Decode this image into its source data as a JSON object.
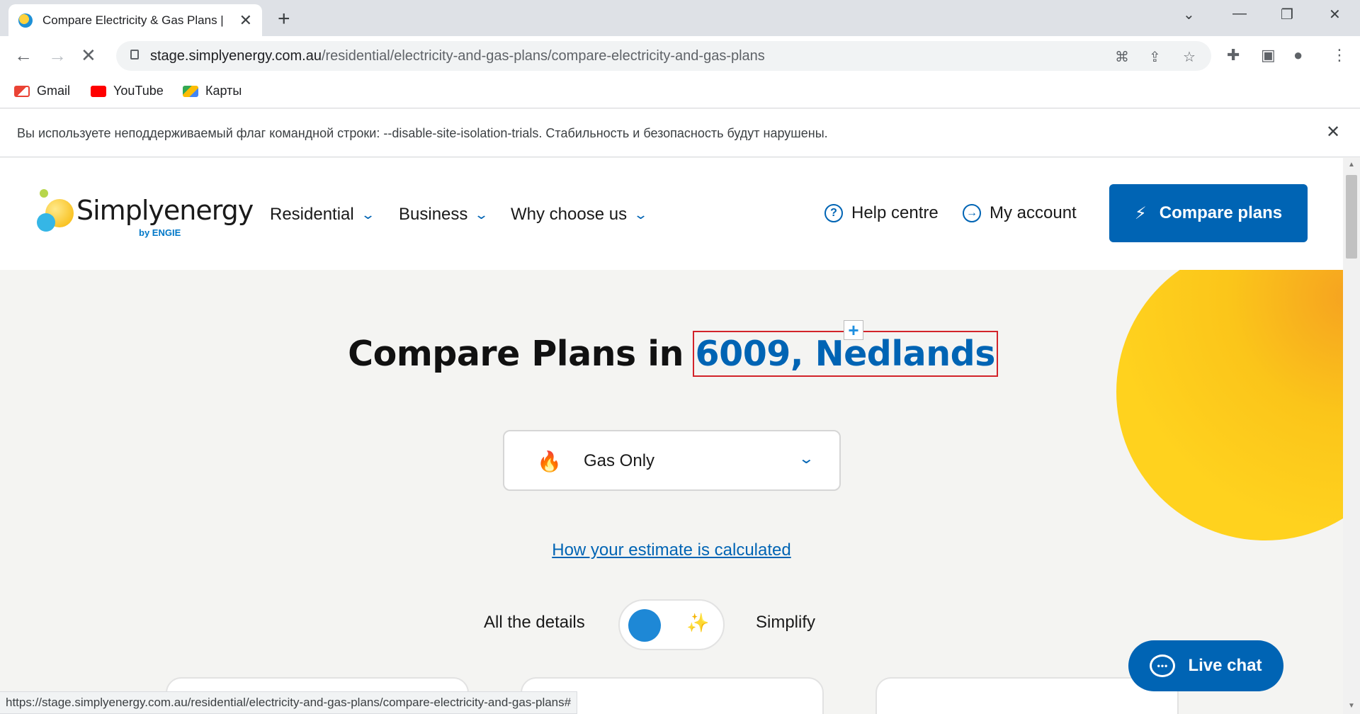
{
  "browser": {
    "tab_title": "Compare Electricity & Gas Plans |",
    "url_host": "stage.simplyenergy.com.au",
    "url_path": "/residential/electricity-and-gas-plans/compare-electricity-and-gas-plans",
    "bookmarks": [
      "Gmail",
      "YouTube",
      "Карты"
    ],
    "infobar_message": "Вы используете неподдерживаемый флаг командной строки: --disable-site-isolation-trials. Стабильность и безопасность будут нарушены.",
    "status_url": "https://stage.simplyenergy.com.au/residential/electricity-and-gas-plans/compare-electricity-and-gas-plans#"
  },
  "header": {
    "logo_text": "Simplyenergy",
    "logo_by": "by ENGIE",
    "menu": [
      "Residential",
      "Business",
      "Why choose us"
    ],
    "help_label": "Help centre",
    "account_label": "My account",
    "compare_button": "Compare plans"
  },
  "main": {
    "heading_prefix": "Compare Plans in",
    "heading_location": "6009, Nedlands",
    "fuel_select_value": "Gas Only",
    "estimate_link": "How your estimate is calculated",
    "toggle_left_label": "All the details",
    "toggle_right_label": "Simplify"
  },
  "live_chat_label": "Live chat",
  "icons": {
    "back": "back-arrow-icon",
    "forward": "forward-arrow-icon",
    "stop": "stop-loading-icon",
    "flame": "flame-icon",
    "wand": "magic-wand-icon"
  },
  "colors": {
    "brand_blue": "#0064b4",
    "sun_yellow": "#ffd21e",
    "highlight_red": "#d2232a"
  }
}
